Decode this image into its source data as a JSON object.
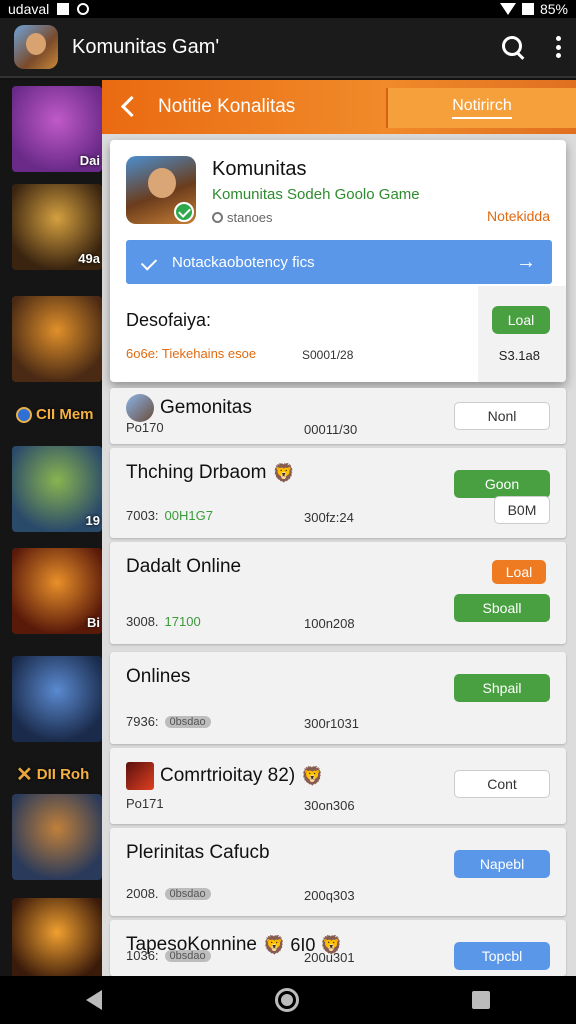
{
  "status_bar": {
    "left_text": "udaval",
    "battery": "85%"
  },
  "app_bar": {
    "title": "Komunitas Gam'"
  },
  "thumbnails": [
    {
      "label": "Dai",
      "colors": [
        "#6a2a88",
        "#c05ac8"
      ]
    },
    {
      "label": "49a",
      "colors": [
        "#3a2410",
        "#d4a040"
      ]
    },
    {
      "label": "",
      "colors": [
        "#4a2a14",
        "#e0902a"
      ]
    },
    {
      "label": "19",
      "colors": [
        "#2a4a6a",
        "#8ab450"
      ]
    },
    {
      "label": "Bi",
      "colors": [
        "#5a1a0a",
        "#e8902a"
      ]
    },
    {
      "label": "",
      "colors": [
        "#1a2a4a",
        "#5a8ad0"
      ]
    },
    {
      "label": "",
      "colors": [
        "#2a3a5a",
        "#c0803a"
      ]
    },
    {
      "label": "",
      "colors": [
        "#3a1a0a",
        "#f0a030"
      ]
    }
  ],
  "thumb_badges": [
    {
      "text": "CII Mem"
    },
    {
      "text": "DII Roh"
    }
  ],
  "notification": {
    "title": "Notitie Konalitas",
    "tab_label": "Notirirch"
  },
  "card": {
    "name": "Komunitas",
    "subtitle": "Komunitas Sodeh Goolo Game",
    "meta": "stanoes",
    "orange_text": "Notekidda",
    "bar_text": "Notackaobotency fics",
    "description": "Desofaiya:",
    "info": "6o6e: Tiekehains esoe",
    "date": "S0001/28",
    "button": "Loal",
    "count": "S3.1a8"
  },
  "items": [
    {
      "title": "Gemonitas",
      "sub": "Po170",
      "date": "00011/30",
      "button": "Nonl",
      "style": "white"
    },
    {
      "title": "Thching Drbaom",
      "sub": "7003:",
      "sub_pill": "00H1G7",
      "date": "300fz:24",
      "button": "Goon",
      "style": "green",
      "extra_button": "B0M",
      "emoji": "🦁"
    },
    {
      "title": "Dadalt Online",
      "sub": "3008.",
      "sub_pill": "17100",
      "date": "100n208",
      "button": "Sboall",
      "style": "green",
      "extra_button": "Loal"
    },
    {
      "title": "Onlines",
      "sub": "7936:",
      "sub_pill": "0bsdao",
      "date": "300r1031",
      "button": "Shpail",
      "style": "green"
    },
    {
      "title": "Comrtrioitay 82)",
      "sub": "Po171",
      "date": "30on306",
      "button": "Cont",
      "style": "white",
      "emoji": "🦁"
    },
    {
      "title": "Plerinitas Cafucb",
      "sub": "2008.",
      "sub_pill": "0bsdao",
      "date": "200q303",
      "button": "Napebl",
      "style": "blue"
    },
    {
      "title": "TapesoKonnine",
      "sub": "1036:",
      "sub_pill": "0bsdao",
      "date": "200u301",
      "button": "Topcbl",
      "style": "blue",
      "emoji": "🦁 6I0 🦁"
    }
  ],
  "colors": {
    "accent_orange": "#ea6a12",
    "green": "#48a040",
    "blue": "#5a97e8"
  }
}
